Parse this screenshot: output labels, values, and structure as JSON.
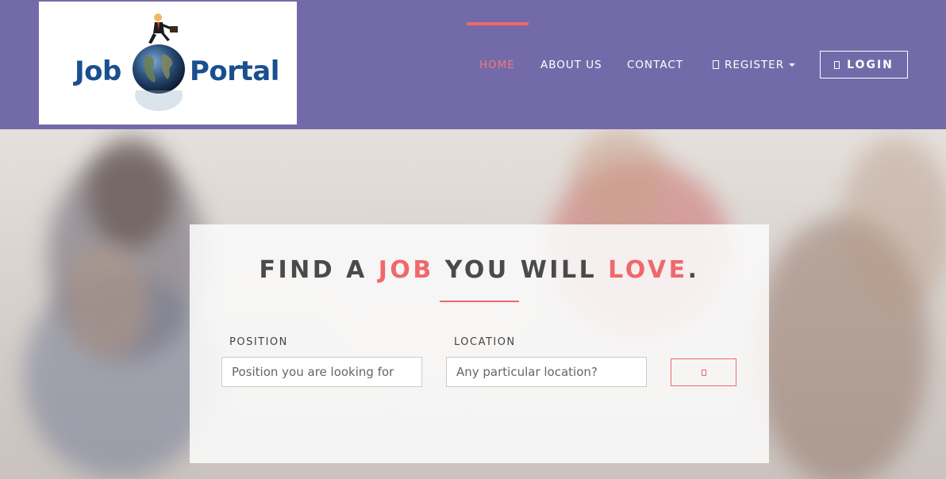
{
  "header": {
    "logo": {
      "word_left": "Job",
      "word_right": "Portal",
      "icon": "globe-businessman-logo"
    },
    "nav": {
      "home": "HOME",
      "about": "ABOUT US",
      "contact": "CONTACT",
      "register": "REGISTER",
      "login": "LOGIN"
    },
    "icons": {
      "register": "user-icon",
      "login": "sign-in-icon",
      "register_caret": "caret-down-icon"
    }
  },
  "hero": {
    "headline": {
      "part1": "FIND A ",
      "accent1": "JOB",
      "part2": " YOU WILL ",
      "accent2": "LOVE",
      "part3": "."
    },
    "search": {
      "position_label": "POSITION",
      "position_placeholder": "Position you are looking for",
      "location_label": "LOCATION",
      "location_placeholder": "Any particular location?",
      "button_icon": "search-icon"
    }
  },
  "colors": {
    "navbar": "#736ba9",
    "accent": "#f0686c",
    "headline_text": "#4a4a4a",
    "logo_text": "#1a4f8f"
  }
}
